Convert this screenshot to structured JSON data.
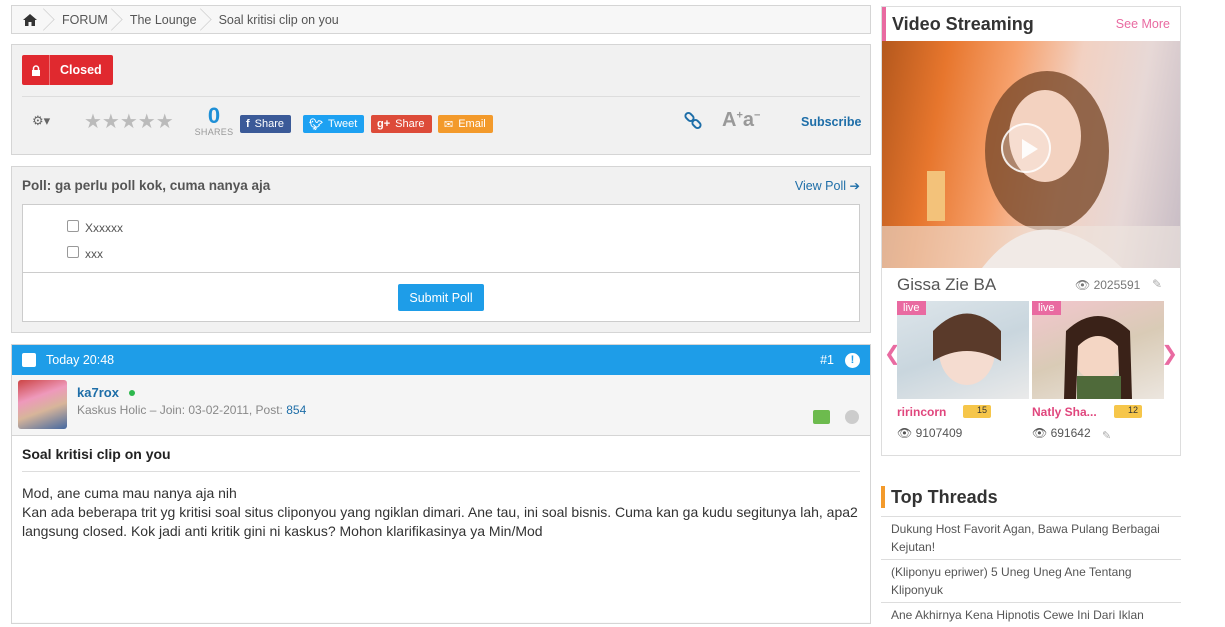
{
  "breadcrumb": {
    "items": [
      "FORUM",
      "The Lounge",
      "Soal kritisi clip on you"
    ]
  },
  "thread_status": {
    "label": "Closed"
  },
  "toolbar": {
    "share_count": "0",
    "share_count_label": "SHARES",
    "facebook_label": "Share",
    "twitter_label": "Tweet",
    "gplus_label": "Share",
    "email_label": "Email",
    "subscribe_label": "Subscribe",
    "rating_stars": "★★★★★"
  },
  "poll": {
    "title": "Poll: ga perlu poll kok, cuma nanya aja",
    "view_label": "View Poll",
    "options": [
      "Xxxxxx",
      "xxx"
    ],
    "submit_label": "Submit Poll"
  },
  "post": {
    "time": "Today 20:48",
    "number": "#1",
    "user": {
      "name": "ka7rox",
      "meta": "Kaskus Holic – Join: 03-02-2011, Post: ",
      "post_count": "854"
    },
    "title": "Soal kritisi clip on you",
    "body_line1": "Mod, ane cuma mau nanya aja nih",
    "body_line2": "Kan ada beberapa trit yg kritisi soal situs cliponyou yang ngiklan dimari. Ane tau, ini soal bisnis. Cuma kan ga kudu segitunya lah, apa2 langsung closed. Kok jadi anti kritik gini ni kaskus? Mohon klarifikasinya ya Min/Mod"
  },
  "video": {
    "title": "Video Streaming",
    "see_more": "See More",
    "featured_name": "Gissa Zie BA",
    "featured_views": "2025591",
    "thumbs": [
      {
        "live": "live",
        "name": "ririncorn",
        "level": "15",
        "views": "9107409"
      },
      {
        "live": "live",
        "name": "Natly Sha...",
        "level": "12",
        "views": "691642"
      }
    ]
  },
  "top_threads": {
    "title": "Top Threads",
    "items": [
      "Dukung Host Favorit Agan, Bawa Pulang Berbagai Kejutan!",
      "(Kliponyu epriwer) 5 Uneg Uneg Ane Tentang Kliponyuk",
      "Ane Akhirnya Kena Hipnotis Cewe Ini Dari Iklan"
    ]
  },
  "colors": {
    "accent": "#1e9de8",
    "closed": "#e0292f",
    "pink": "#e96aa1",
    "orange": "#f39a2b"
  }
}
